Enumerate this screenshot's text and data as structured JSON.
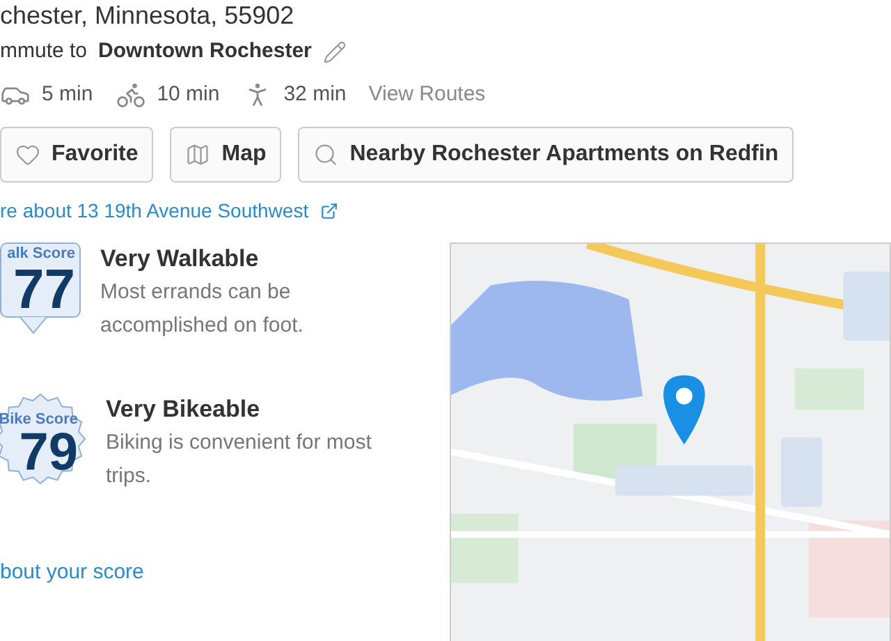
{
  "address": "chester, Minnesota, 55902",
  "commute": {
    "prefix": "mmute to",
    "destination": "Downtown Rochester"
  },
  "travel_times": [
    {
      "kind": "drive",
      "time": "5 min"
    },
    {
      "kind": "bike",
      "time": "10 min"
    },
    {
      "kind": "walk",
      "time": "32 min"
    }
  ],
  "view_routes": "View Routes",
  "buttons": [
    {
      "kind": "favorite",
      "label": "Favorite"
    },
    {
      "kind": "map",
      "label": "Map"
    },
    {
      "kind": "search",
      "label": "Nearby Rochester Apartments on Redfin"
    }
  ],
  "more_link": "re about 13 19th Avenue Southwest",
  "scores": [
    {
      "kind": "walk",
      "badge": "alk Score",
      "value": "77",
      "title": "Very Walkable",
      "description": "Most errands can be accomplished on foot."
    },
    {
      "kind": "bike",
      "badge": "Bike Score",
      "value": "79",
      "title": "Very Bikeable",
      "description": "Biking is convenient for most trips."
    }
  ],
  "score_link": "bout your score"
}
